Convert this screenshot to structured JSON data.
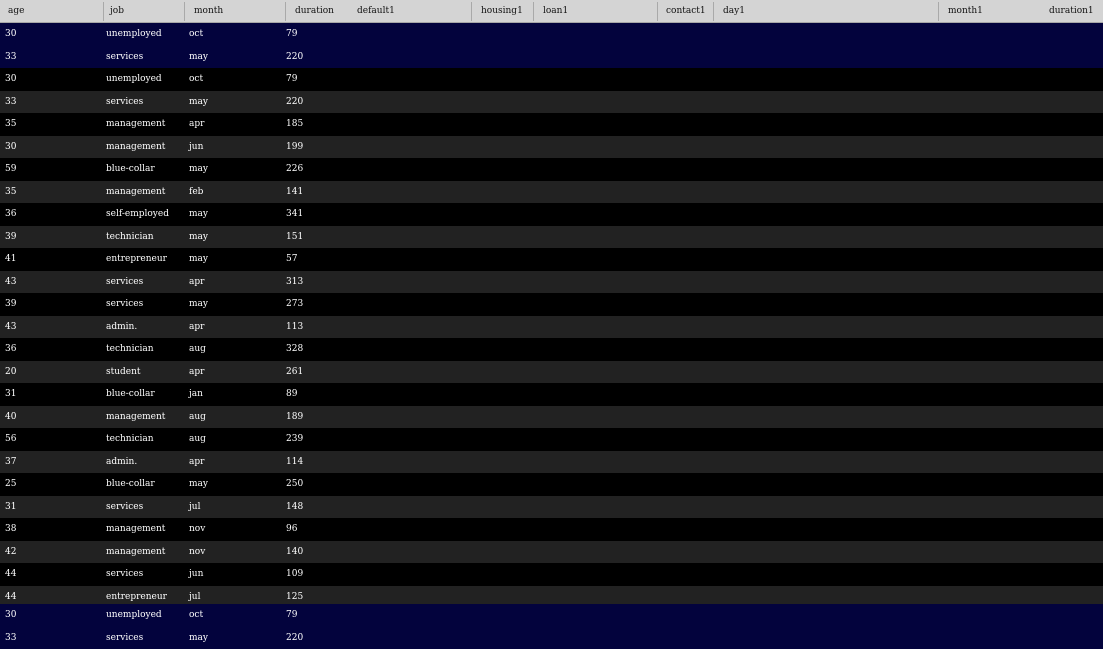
{
  "header": {
    "columns": [
      "age",
      "job",
      "month",
      "duration",
      "default1",
      "housing1",
      "loan1",
      "contact1",
      "day1",
      "month1",
      "duration1"
    ]
  },
  "pinned_top": [
    {
      "age": "30",
      "job": "unemployed",
      "month": "oct",
      "duration": "79"
    },
    {
      "age": "33",
      "job": "services",
      "month": "may",
      "duration": "220"
    }
  ],
  "rows": [
    {
      "age": "30",
      "job": "unemployed",
      "month": "oct",
      "duration": "79"
    },
    {
      "age": "33",
      "job": "services",
      "month": "may",
      "duration": "220"
    },
    {
      "age": "35",
      "job": "management",
      "month": "apr",
      "duration": "185"
    },
    {
      "age": "30",
      "job": "management",
      "month": "jun",
      "duration": "199"
    },
    {
      "age": "59",
      "job": "blue-collar",
      "month": "may",
      "duration": "226"
    },
    {
      "age": "35",
      "job": "management",
      "month": "feb",
      "duration": "141"
    },
    {
      "age": "36",
      "job": "self-employed",
      "month": "may",
      "duration": "341"
    },
    {
      "age": "39",
      "job": "technician",
      "month": "may",
      "duration": "151"
    },
    {
      "age": "41",
      "job": "entrepreneur",
      "month": "may",
      "duration": "57"
    },
    {
      "age": "43",
      "job": "services",
      "month": "apr",
      "duration": "313"
    },
    {
      "age": "39",
      "job": "services",
      "month": "may",
      "duration": "273"
    },
    {
      "age": "43",
      "job": "admin.",
      "month": "apr",
      "duration": "113"
    },
    {
      "age": "36",
      "job": "technician",
      "month": "aug",
      "duration": "328"
    },
    {
      "age": "20",
      "job": "student",
      "month": "apr",
      "duration": "261"
    },
    {
      "age": "31",
      "job": "blue-collar",
      "month": "jan",
      "duration": "89"
    },
    {
      "age": "40",
      "job": "management",
      "month": "aug",
      "duration": "189"
    },
    {
      "age": "56",
      "job": "technician",
      "month": "aug",
      "duration": "239"
    },
    {
      "age": "37",
      "job": "admin.",
      "month": "apr",
      "duration": "114"
    },
    {
      "age": "25",
      "job": "blue-collar",
      "month": "may",
      "duration": "250"
    },
    {
      "age": "31",
      "job": "services",
      "month": "jul",
      "duration": "148"
    },
    {
      "age": "38",
      "job": "management",
      "month": "nov",
      "duration": "96"
    },
    {
      "age": "42",
      "job": "management",
      "month": "nov",
      "duration": "140"
    },
    {
      "age": "44",
      "job": "services",
      "month": "jun",
      "duration": "109"
    },
    {
      "age": "44",
      "job": "entrepreneur",
      "month": "jul",
      "duration": "125"
    }
  ],
  "pinned_bottom": [
    {
      "age": "30",
      "job": "unemployed",
      "month": "oct",
      "duration": "79"
    },
    {
      "age": "33",
      "job": "services",
      "month": "may",
      "duration": "220"
    }
  ],
  "colors": {
    "header_bg": "#d4d4d4",
    "pinned_bg": "#03033d",
    "row_odd_bg": "#000000",
    "row_even_bg": "#222222",
    "text": "#ffffff"
  }
}
